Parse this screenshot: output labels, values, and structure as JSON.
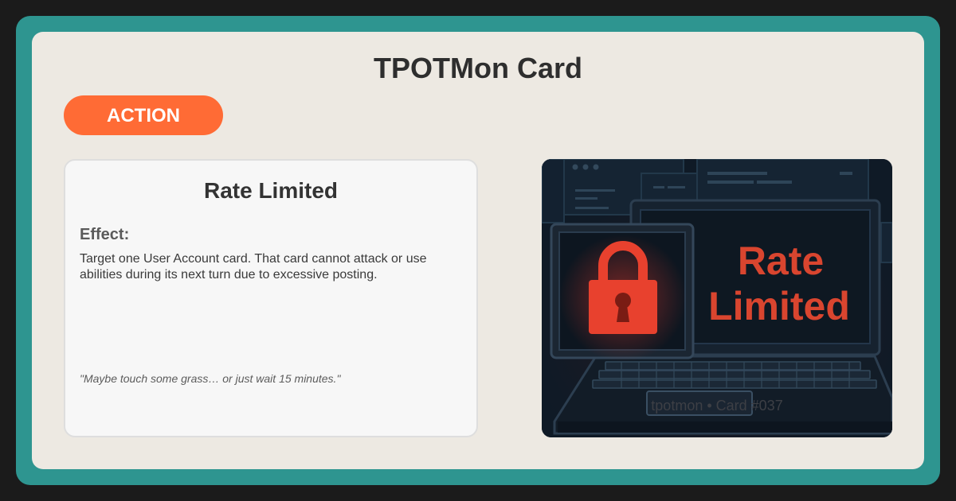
{
  "header": {
    "title": "TPOTMon Card"
  },
  "card": {
    "type_badge": "ACTION",
    "name": "Rate Limited",
    "effect_label": "Effect:",
    "effect_text": "Target one User Account card. That card cannot attack or use abilities during its next turn due to excessive posting.",
    "flavor_text": "\"Maybe touch some grass… or just wait 15 minutes.\""
  },
  "art": {
    "screen_line1": "Rate",
    "screen_line2": "Limited",
    "lock_icon": "padlock-icon",
    "footer": "tpotmon • Card #037"
  },
  "colors": {
    "frame": "#2e9590",
    "panel": "#ede9e2",
    "badge": "#ff6b35",
    "lock_red": "#e8412e",
    "screen_text_red": "#d9452f"
  }
}
